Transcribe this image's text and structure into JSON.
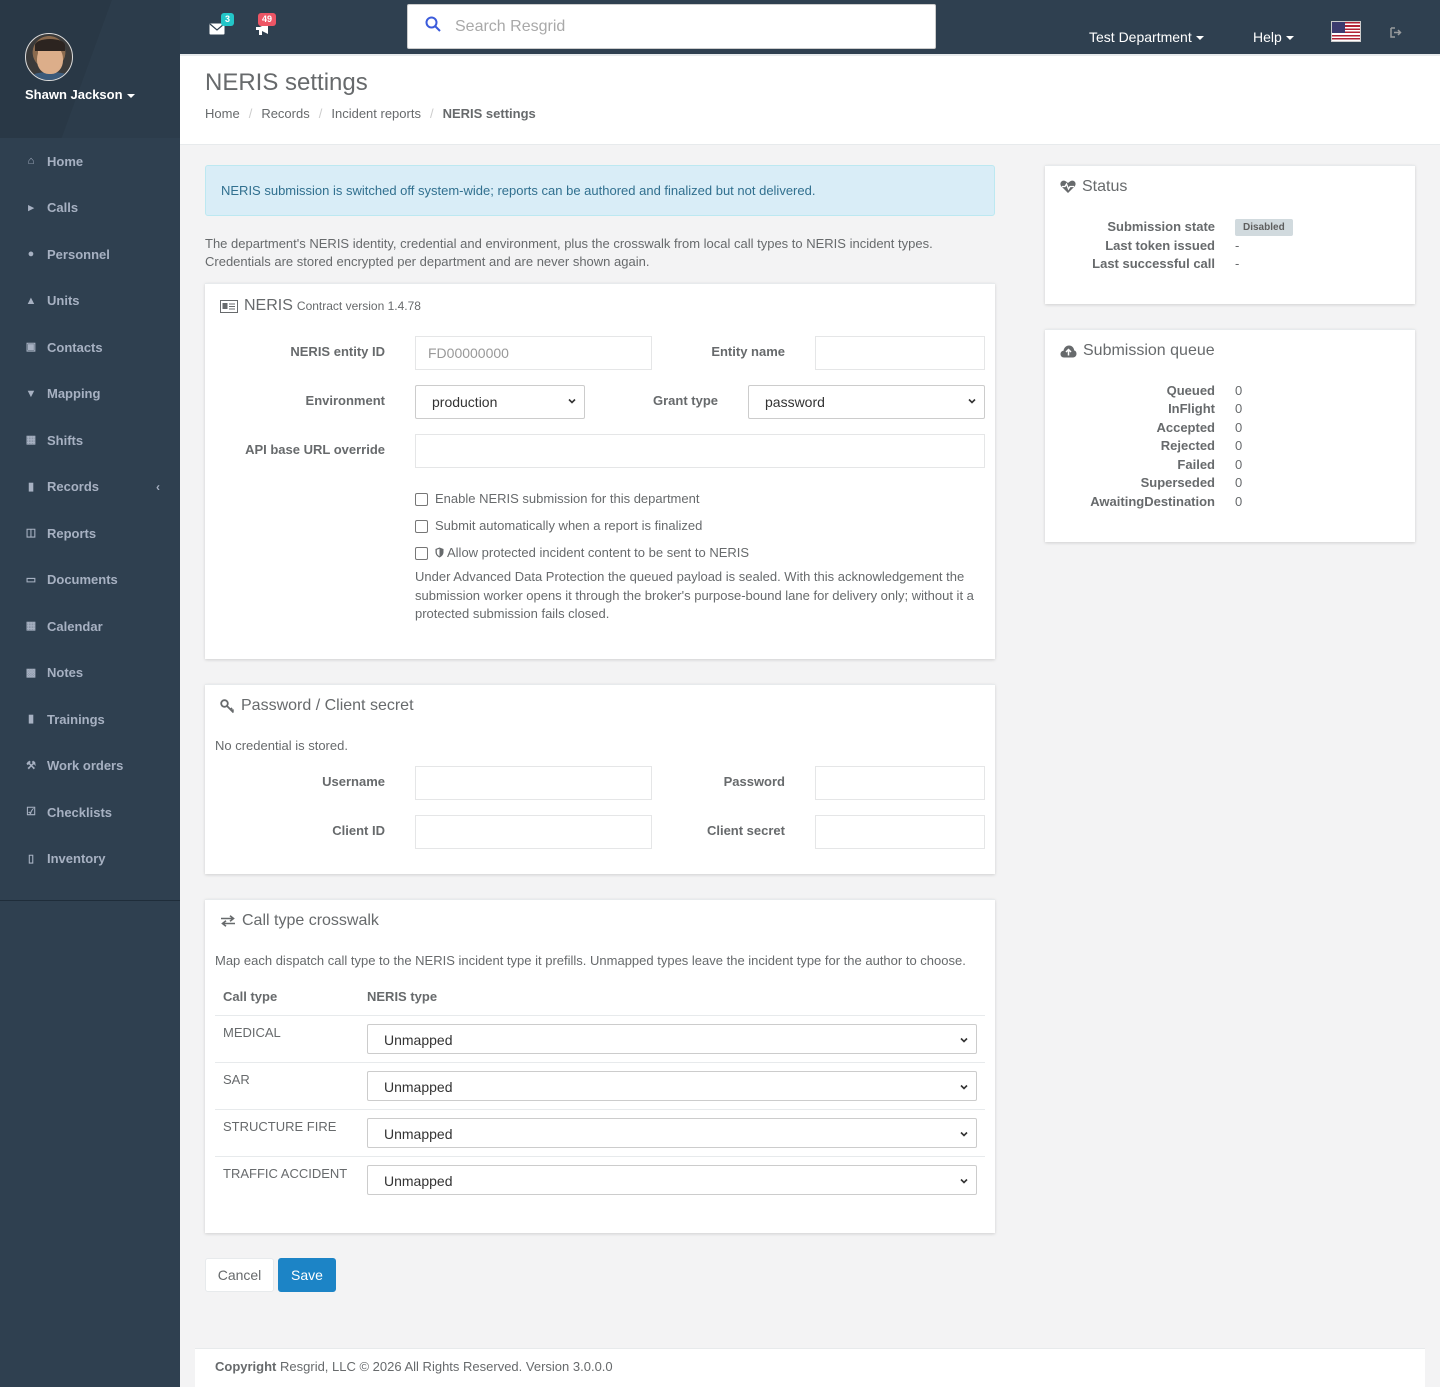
{
  "user": {
    "name": "Shawn Jackson"
  },
  "sidebar": {
    "items": [
      {
        "label": "Home",
        "icon": "home-icon"
      },
      {
        "label": "Calls",
        "icon": "bullhorn-icon"
      },
      {
        "label": "Personnel",
        "icon": "user-icon"
      },
      {
        "label": "Units",
        "icon": "truck-icon"
      },
      {
        "label": "Contacts",
        "icon": "address-book-icon"
      },
      {
        "label": "Mapping",
        "icon": "map-marker-icon"
      },
      {
        "label": "Shifts",
        "icon": "shifts-icon"
      },
      {
        "label": "Records",
        "icon": "file-icon"
      },
      {
        "label": "Reports",
        "icon": "reports-icon"
      },
      {
        "label": "Documents",
        "icon": "documents-icon"
      },
      {
        "label": "Calendar",
        "icon": "calendar-icon"
      },
      {
        "label": "Notes",
        "icon": "notes-icon"
      },
      {
        "label": "Trainings",
        "icon": "trainings-icon"
      },
      {
        "label": "Work orders",
        "icon": "wrench-icon"
      },
      {
        "label": "Checklists",
        "icon": "checklist-icon"
      },
      {
        "label": "Inventory",
        "icon": "barcode-icon"
      }
    ]
  },
  "topbar": {
    "messages_count": "3",
    "calls_count": "49",
    "search_placeholder": "Search Resgrid",
    "department": "Test Department",
    "help": "Help",
    "colors": {
      "messages_badge": "#23c6c8",
      "calls_badge": "#ed5565"
    }
  },
  "page": {
    "title": "NERIS settings",
    "breadcrumb": [
      "Home",
      "Records",
      "Incident reports",
      "NERIS settings"
    ]
  },
  "alert": "NERIS submission is switched off system-wide; reports can be authored and finalized but not delivered.",
  "intro": "The department's NERIS identity, credential and environment, plus the crosswalk from local call types to NERIS incident types. Credentials are stored encrypted per department and are never shown again.",
  "neris_panel": {
    "title": "NERIS",
    "contract": "Contract version 1.4.78",
    "entity_id_label": "NERIS entity ID",
    "entity_id_placeholder": "FD00000000",
    "entity_name_label": "Entity name",
    "environment_label": "Environment",
    "environment_value": "production",
    "grant_type_label": "Grant type",
    "grant_type_value": "password",
    "api_url_label": "API base URL override",
    "check_enable": "Enable NERIS submission for this department",
    "check_auto": "Submit automatically when a report is finalized",
    "check_protected": "Allow protected incident content to be sent to NERIS",
    "help": "Under Advanced Data Protection the queued payload is sealed. With this acknowledgement the submission worker opens it through the broker's purpose-bound lane for delivery only; without it a protected submission fails closed."
  },
  "credential_panel": {
    "title": "Password / Client secret",
    "note": "No credential is stored.",
    "username_label": "Username",
    "password_label": "Password",
    "client_id_label": "Client ID",
    "client_secret_label": "Client secret"
  },
  "crosswalk_panel": {
    "title": "Call type crosswalk",
    "description": "Map each dispatch call type to the NERIS incident type it prefills. Unmapped types leave the incident type for the author to choose.",
    "col_call_type": "Call type",
    "col_neris_type": "NERIS type",
    "rows": [
      {
        "call_type": "MEDICAL",
        "neris_type": "Unmapped"
      },
      {
        "call_type": "SAR",
        "neris_type": "Unmapped"
      },
      {
        "call_type": "STRUCTURE FIRE",
        "neris_type": "Unmapped"
      },
      {
        "call_type": "TRAFFIC ACCIDENT",
        "neris_type": "Unmapped"
      }
    ]
  },
  "buttons": {
    "cancel": "Cancel",
    "save": "Save"
  },
  "status_panel": {
    "title": "Status",
    "rows": [
      {
        "label": "Submission state",
        "value": "Disabled"
      },
      {
        "label": "Last token issued",
        "value": "-"
      },
      {
        "label": "Last successful call",
        "value": "-"
      }
    ]
  },
  "queue_panel": {
    "title": "Submission queue",
    "rows": [
      {
        "label": "Queued",
        "value": "0"
      },
      {
        "label": "InFlight",
        "value": "0"
      },
      {
        "label": "Accepted",
        "value": "0"
      },
      {
        "label": "Rejected",
        "value": "0"
      },
      {
        "label": "Failed",
        "value": "0"
      },
      {
        "label": "Superseded",
        "value": "0"
      },
      {
        "label": "AwaitingDestination",
        "value": "0"
      }
    ]
  },
  "footer": {
    "copyright": "Copyright",
    "company": "Resgrid, LLC © 2026 All Rights Reserved.",
    "version": "Version 3.0.0.0"
  }
}
